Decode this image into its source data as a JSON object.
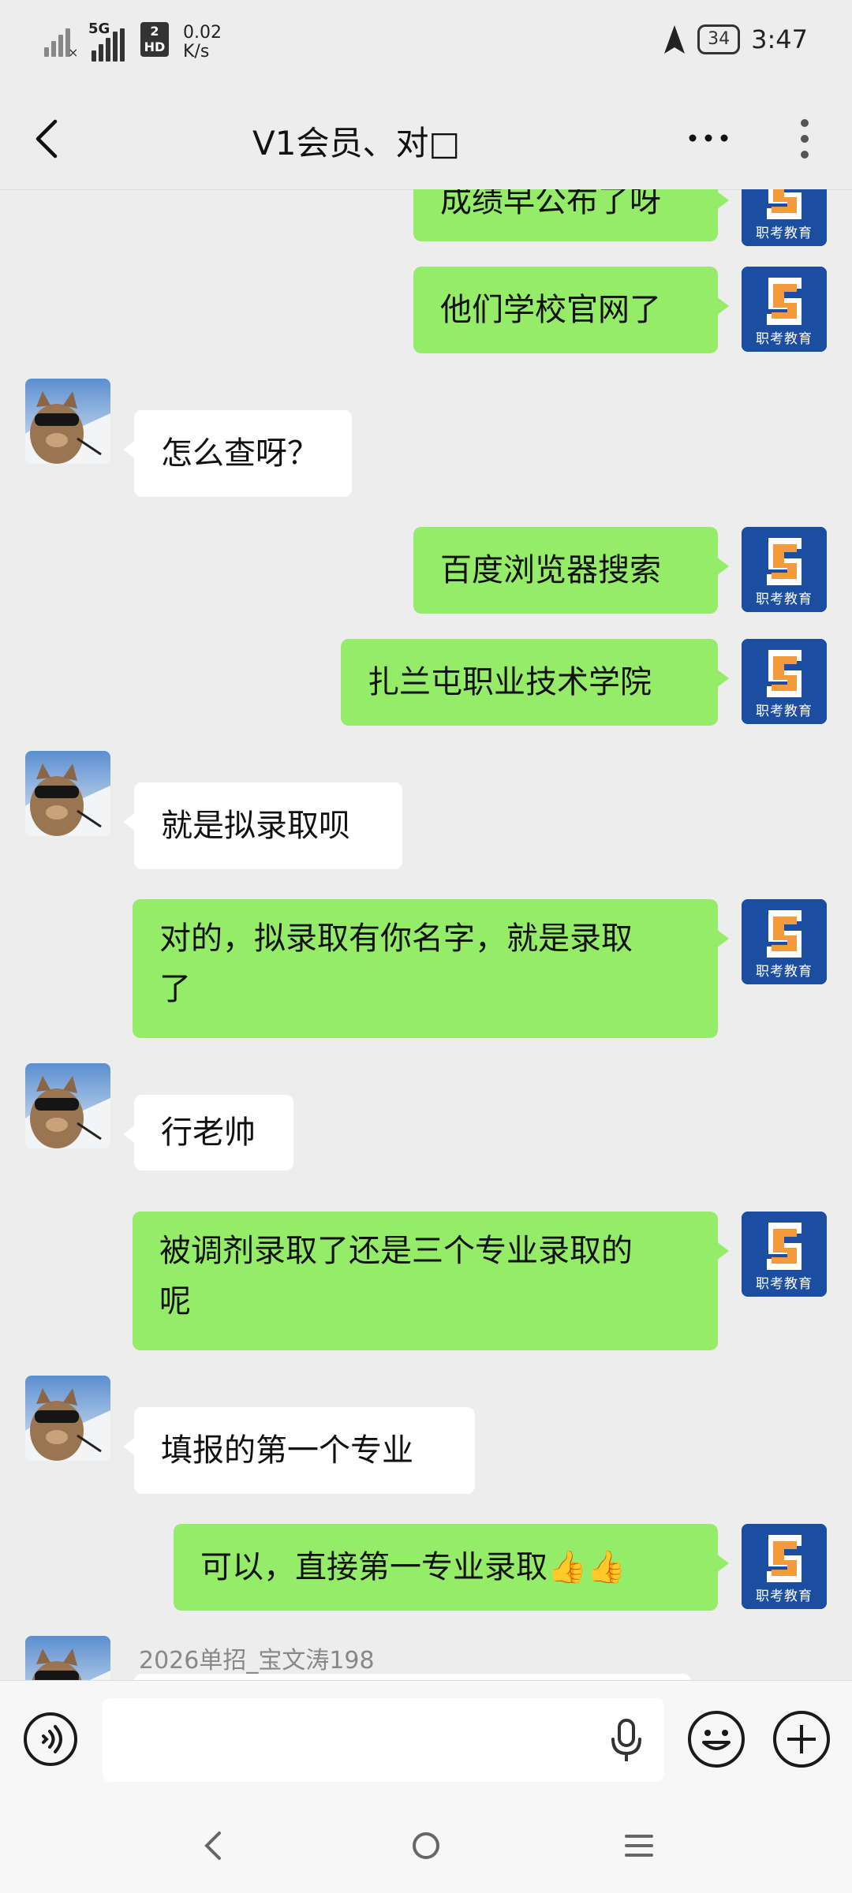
{
  "status_bar": {
    "network_5g": "5G",
    "sim2_line1": "2",
    "sim2_line2": "HD",
    "speed_value": "0.02",
    "speed_unit": "K/s",
    "battery": "34",
    "time": "3:47"
  },
  "header": {
    "title": "V1会员、对□"
  },
  "messages": [
    {
      "side": "me",
      "text": "成绩早公布了呀"
    },
    {
      "side": "me",
      "text": "他们学校官网了"
    },
    {
      "side": "other",
      "text": "怎么查呀？"
    },
    {
      "side": "me",
      "text": "百度浏览器搜索"
    },
    {
      "side": "me",
      "text": "扎兰屯职业技术学院"
    },
    {
      "side": "other",
      "text": "就是拟录取呗"
    },
    {
      "side": "me",
      "text": "对的，拟录取有你名字，就是录取\n了"
    },
    {
      "side": "other",
      "text": "行老帅"
    },
    {
      "side": "me",
      "text": "被调剂录取了还是三个专业录取的\n呢"
    },
    {
      "side": "other",
      "text": "填报的第一个专业"
    },
    {
      "side": "me",
      "text": "可以，直接第一专业录取👍👍"
    }
  ],
  "last_sender_name": "2026单招_宝文涛198",
  "brand_avatar_text": "职考教育",
  "icons": {
    "back": "chevron-left-icon",
    "more": "more-dots-icon",
    "kebab": "vertical-dots-icon",
    "voice": "voice-input-icon",
    "mic": "microphone-icon",
    "emoji": "emoji-icon",
    "plus": "plus-icon"
  },
  "colors": {
    "my_bubble": "#95ec69",
    "other_bubble": "#ffffff",
    "background": "#ededed",
    "brand_blue": "#1b4ea0",
    "brand_orange": "#f39a3c"
  }
}
